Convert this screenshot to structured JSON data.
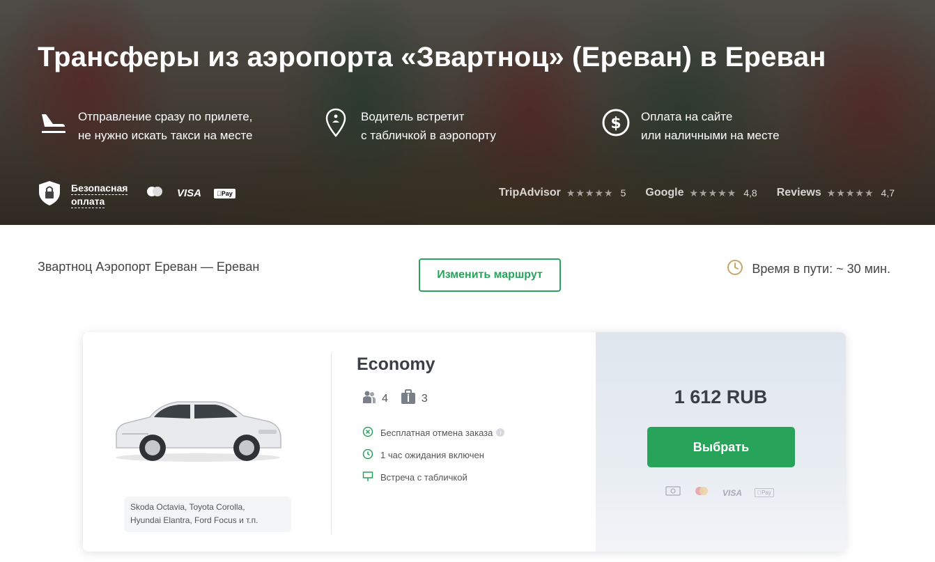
{
  "hero": {
    "title": "Трансферы из аэропорта «Звартноц» (Ереван) в Ереван",
    "features": [
      {
        "icon": "plane-landing-icon",
        "line1": "Отправление сразу по прилете,",
        "line2": "не нужно искать такси на месте"
      },
      {
        "icon": "location-pin-icon",
        "line1": "Водитель встретит",
        "line2": "с табличкой в аэропорту"
      },
      {
        "icon": "dollar-coin-icon",
        "line1": "Оплата на сайте",
        "line2": "или наличными на месте"
      }
    ],
    "secure_payment": {
      "line1": "Безопасная",
      "line2": "оплата"
    },
    "payment_methods": {
      "visa": "VISA",
      "apple_pay": "Pay"
    },
    "ratings": [
      {
        "name": "TripAdvisor",
        "stars": "★★★★★",
        "value": "5"
      },
      {
        "name": "Google",
        "stars": "★★★★★",
        "value": "4,8"
      },
      {
        "name": "Reviews",
        "stars": "★★★★★",
        "value": "4,7"
      }
    ]
  },
  "route": {
    "text": "Звартноц Аэропорт Ереван — Ереван",
    "change_label": "Изменить маршрут",
    "travel_time": "Время в пути: ~ 30 мин."
  },
  "offer": {
    "class_name": "Economy",
    "passengers": "4",
    "luggage": "3",
    "models_line1": "Skoda Octavia, Toyota Corolla,",
    "models_line2": "Hyundai Elantra, Ford Focus и т.п.",
    "perks": [
      "Бесплатная отмена заказа",
      "1 час ожидания включен",
      "Встреча с табличкой"
    ],
    "price": "1 612 RUB",
    "select_label": "Выбрать",
    "visa": "VISA",
    "apple_pay": "Pay"
  },
  "colors": {
    "accent": "#27a35a",
    "price_panel": "#dfe6ee",
    "clock": "#c9a56a"
  }
}
